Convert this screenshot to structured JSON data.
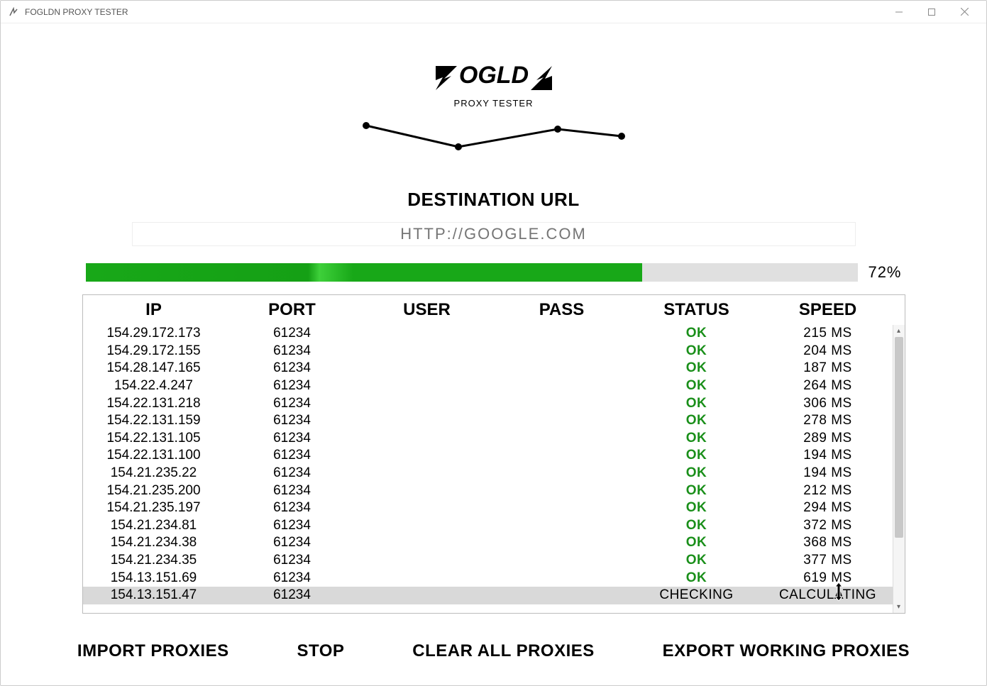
{
  "window": {
    "title": "FOGLDN PROXY TESTER"
  },
  "logo": {
    "main": "FOGLDN",
    "sub": "PROXY TESTER"
  },
  "destination": {
    "label": "DESTINATION URL",
    "placeholder": "HTTP://GOOGLE.COM",
    "value": ""
  },
  "progress": {
    "percent": 72,
    "label": "72%"
  },
  "table": {
    "headers": {
      "ip": "IP",
      "port": "PORT",
      "user": "USER",
      "pass": "PASS",
      "status": "STATUS",
      "speed": "SPEED"
    },
    "rows": [
      {
        "ip": "154.29.172.173",
        "port": "61234",
        "user": "",
        "pass": "",
        "status": "OK",
        "speed": "215 MS"
      },
      {
        "ip": "154.29.172.155",
        "port": "61234",
        "user": "",
        "pass": "",
        "status": "OK",
        "speed": "204 MS"
      },
      {
        "ip": "154.28.147.165",
        "port": "61234",
        "user": "",
        "pass": "",
        "status": "OK",
        "speed": "187 MS"
      },
      {
        "ip": "154.22.4.247",
        "port": "61234",
        "user": "",
        "pass": "",
        "status": "OK",
        "speed": "264 MS"
      },
      {
        "ip": "154.22.131.218",
        "port": "61234",
        "user": "",
        "pass": "",
        "status": "OK",
        "speed": "306 MS"
      },
      {
        "ip": "154.22.131.159",
        "port": "61234",
        "user": "",
        "pass": "",
        "status": "OK",
        "speed": "278 MS"
      },
      {
        "ip": "154.22.131.105",
        "port": "61234",
        "user": "",
        "pass": "",
        "status": "OK",
        "speed": "289 MS"
      },
      {
        "ip": "154.22.131.100",
        "port": "61234",
        "user": "",
        "pass": "",
        "status": "OK",
        "speed": "194 MS"
      },
      {
        "ip": "154.21.235.22",
        "port": "61234",
        "user": "",
        "pass": "",
        "status": "OK",
        "speed": "194 MS"
      },
      {
        "ip": "154.21.235.200",
        "port": "61234",
        "user": "",
        "pass": "",
        "status": "OK",
        "speed": "212 MS"
      },
      {
        "ip": "154.21.235.197",
        "port": "61234",
        "user": "",
        "pass": "",
        "status": "OK",
        "speed": "294 MS"
      },
      {
        "ip": "154.21.234.81",
        "port": "61234",
        "user": "",
        "pass": "",
        "status": "OK",
        "speed": "372 MS"
      },
      {
        "ip": "154.21.234.38",
        "port": "61234",
        "user": "",
        "pass": "",
        "status": "OK",
        "speed": "368 MS"
      },
      {
        "ip": "154.21.234.35",
        "port": "61234",
        "user": "",
        "pass": "",
        "status": "OK",
        "speed": "377 MS"
      },
      {
        "ip": "154.13.151.69",
        "port": "61234",
        "user": "",
        "pass": "",
        "status": "OK",
        "speed": "619 MS"
      },
      {
        "ip": "154.13.151.47",
        "port": "61234",
        "user": "",
        "pass": "",
        "status": "CHECKING",
        "speed": "CALCULATING"
      }
    ]
  },
  "buttons": {
    "import": "IMPORT PROXIES",
    "stop": "STOP",
    "clear": "CLEAR ALL PROXIES",
    "export": "EXPORT WORKING PROXIES"
  }
}
